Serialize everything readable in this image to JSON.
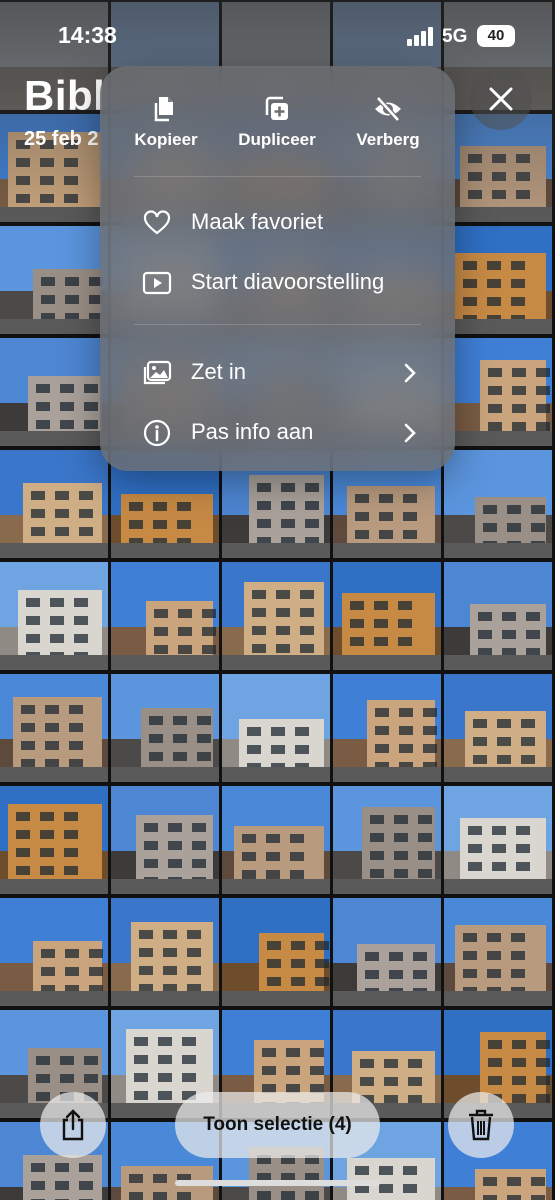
{
  "status_bar": {
    "time": "14:38",
    "network": "5G",
    "battery": "40"
  },
  "header": {
    "title": "Bibl",
    "date": "25 feb 2"
  },
  "menu": {
    "actions": [
      {
        "label": "Kopieer",
        "icon": "copy-icon"
      },
      {
        "label": "Dupliceer",
        "icon": "duplicate-icon"
      },
      {
        "label": "Verberg",
        "icon": "hide-icon"
      }
    ],
    "items": [
      {
        "label": "Maak favoriet",
        "icon": "heart-icon"
      },
      {
        "label": "Start diavoorstelling",
        "icon": "play-icon"
      },
      {
        "label": "Zet in",
        "icon": "photos-icon",
        "chevron": true
      },
      {
        "label": "Pas info aan",
        "icon": "info-icon",
        "chevron": true
      }
    ]
  },
  "toolbar": {
    "selection_label": "Toon selectie (4)"
  },
  "colors": {
    "sky": "#3f7fd6",
    "menu_bg": "#6e7076",
    "facade_beige": "#c9a47c",
    "facade_orange": "#c78a45"
  }
}
